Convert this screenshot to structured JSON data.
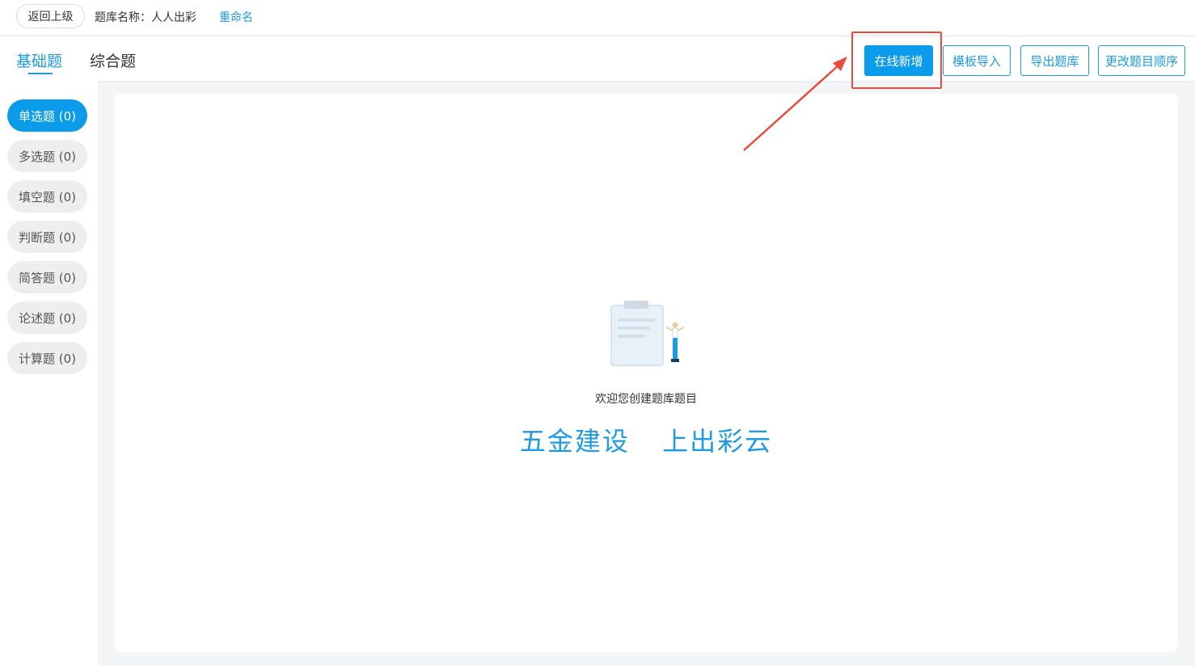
{
  "topbar": {
    "back_label": "返回上级",
    "bank_name_label": "题库名称：人人出彩",
    "rename_label": "重命名"
  },
  "tabs": [
    {
      "label": "基础题",
      "active": true
    },
    {
      "label": "综合题",
      "active": false
    }
  ],
  "toolbar": {
    "add_online": "在线新增",
    "template_import": "模板导入",
    "export_bank": "导出题库",
    "change_order": "更改题目顺序"
  },
  "sidebar": {
    "items": [
      {
        "label": "单选题 (0)",
        "active": true
      },
      {
        "label": "多选题 (0)",
        "active": false
      },
      {
        "label": "填空题 (0)",
        "active": false
      },
      {
        "label": "判断题 (0)",
        "active": false
      },
      {
        "label": "简答题 (0)",
        "active": false
      },
      {
        "label": "论述题 (0)",
        "active": false
      },
      {
        "label": "计算题 (0)",
        "active": false
      }
    ]
  },
  "main": {
    "welcome": "欢迎您创建题库题目",
    "slogan_left": "五金建设",
    "slogan_right": "上出彩云"
  },
  "colors": {
    "accent": "#0a9bea",
    "link": "#1e9be0",
    "annotation": "#e74c3c"
  },
  "icons": [
    "clipboard-empty-icon",
    "person-shrug-icon"
  ]
}
